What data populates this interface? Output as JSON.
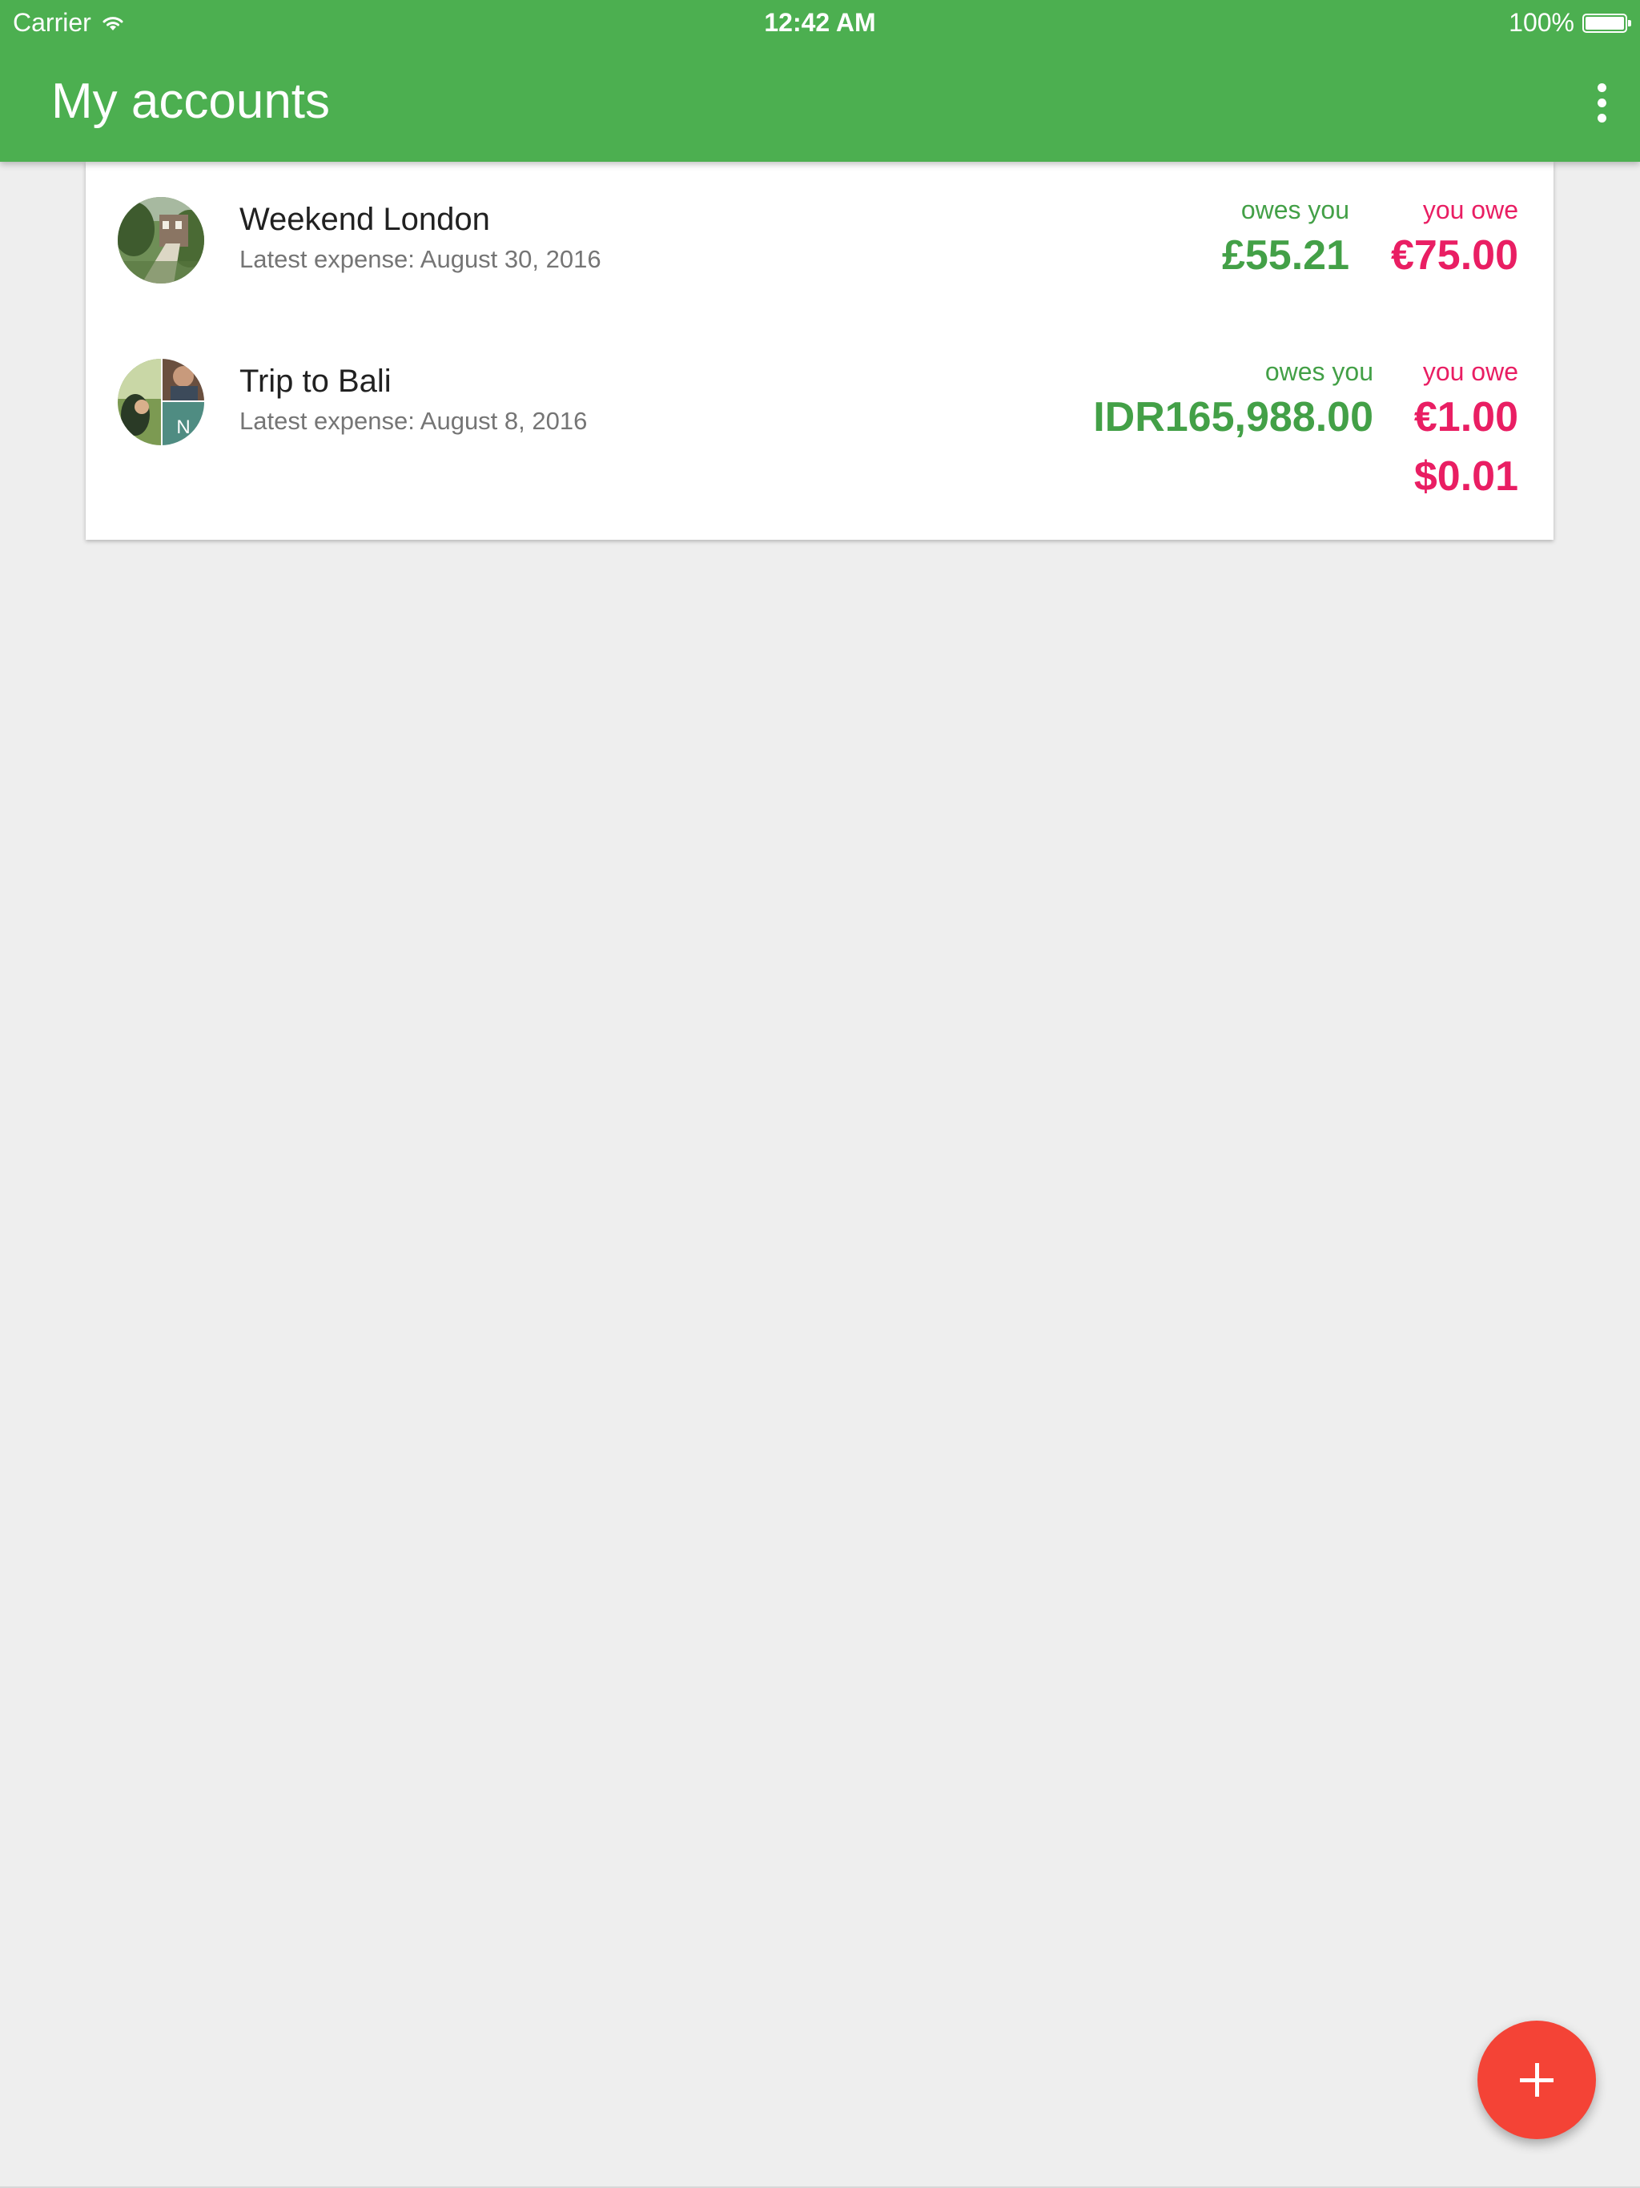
{
  "status_bar": {
    "carrier": "Carrier",
    "time": "12:42 AM",
    "battery": "100%"
  },
  "app_bar": {
    "title": "My accounts",
    "color": "#4caf50",
    "menu_icon": "more-vert-icon"
  },
  "accounts": [
    {
      "name": "Weekend London",
      "latest": "Latest expense: August 30, 2016",
      "avatar_icon": "group-photo-avatar",
      "owes_you_label": "owes you",
      "owes_you": [
        "£55.21"
      ],
      "you_owe_label": "you owe",
      "you_owe": [
        "€75.00"
      ]
    },
    {
      "name": "Trip to Bali",
      "latest": "Latest expense: August 8, 2016",
      "avatar_icon": "group-collage-avatar",
      "avatar_initial": "N",
      "owes_you_label": "owes you",
      "owes_you": [
        "IDR165,988.00"
      ],
      "you_owe_label": "you owe",
      "you_owe": [
        "€1.00",
        "$0.01"
      ]
    }
  ],
  "fab": {
    "icon": "plus-icon",
    "color": "#f44336"
  },
  "colors": {
    "positive": "#43a047",
    "negative": "#e91e63",
    "background": "#eeeeee"
  }
}
